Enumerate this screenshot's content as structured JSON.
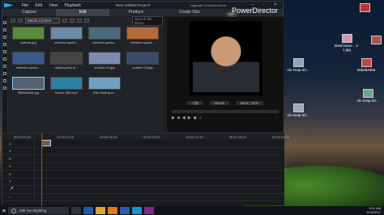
{
  "app": {
    "menu": [
      "File",
      "Edit",
      "View",
      "Playback"
    ],
    "project": "New Untitled Project*",
    "upgrade_link": "Upgrade to DirectorZone",
    "brand": "PowerDirector",
    "app_badge": "APP",
    "window_controls": "– ▫ ✕",
    "modes": [
      "Capture",
      "Edit",
      "Produce",
      "Create Disc"
    ]
  },
  "library": {
    "filter": "Media Content",
    "search_placeholder": "Search the library",
    "items": [
      {
        "label": "balloon.jpg",
        "color": "#5a8a3a"
      },
      {
        "label": "extreme sports...",
        "color": "#6a8aa8"
      },
      {
        "label": "extreme sports...",
        "color": "#4a6a7a"
      },
      {
        "label": "extreme sports...",
        "color": "#b56a3a"
      },
      {
        "label": "extreme sports...",
        "color": "#3a5a8a"
      },
      {
        "label": "motorcycles.m...",
        "color": "#444"
      },
      {
        "label": "sunrise 01.jpg",
        "color": "#7a8ab0"
      },
      {
        "label": "sunrise 02.jpg",
        "color": "#3a4a6a"
      },
      {
        "label": "555664656.jpg",
        "color": "#556070"
      },
      {
        "label": "beach 365.mp4",
        "color": "#2a80a0"
      },
      {
        "label": "Kite Surfing.w...",
        "color": "#70a0c0"
      }
    ]
  },
  "preview": {
    "tab_clip": "Clip",
    "tab_movie": "Movie",
    "quality": "Best | 16:9"
  },
  "timeline": {
    "ruler": [
      "00:00:00:00",
      "00:00:03:10",
      "00:00:06:20",
      "00:00:10:00",
      "00:00:13:10",
      "00:00:16:20",
      "00:00:20:00"
    ],
    "tracks": [
      "1.",
      "1.",
      "fx",
      "2.",
      "2.",
      "T",
      "🎤",
      "♪"
    ]
  },
  "desktop": {
    "icons": [
      {
        "label": "Most-beau... 1-1.jpg"
      },
      {
        "label": "vlc-snap-20..."
      },
      {
        "label": "555664656"
      },
      {
        "label": "vlc-snap-20..."
      },
      {
        "label": "vlc-snap-20..."
      }
    ]
  },
  "taskbar": {
    "search": "Ask me anything",
    "time": "9:01 AM",
    "date": "10/3/2017"
  }
}
